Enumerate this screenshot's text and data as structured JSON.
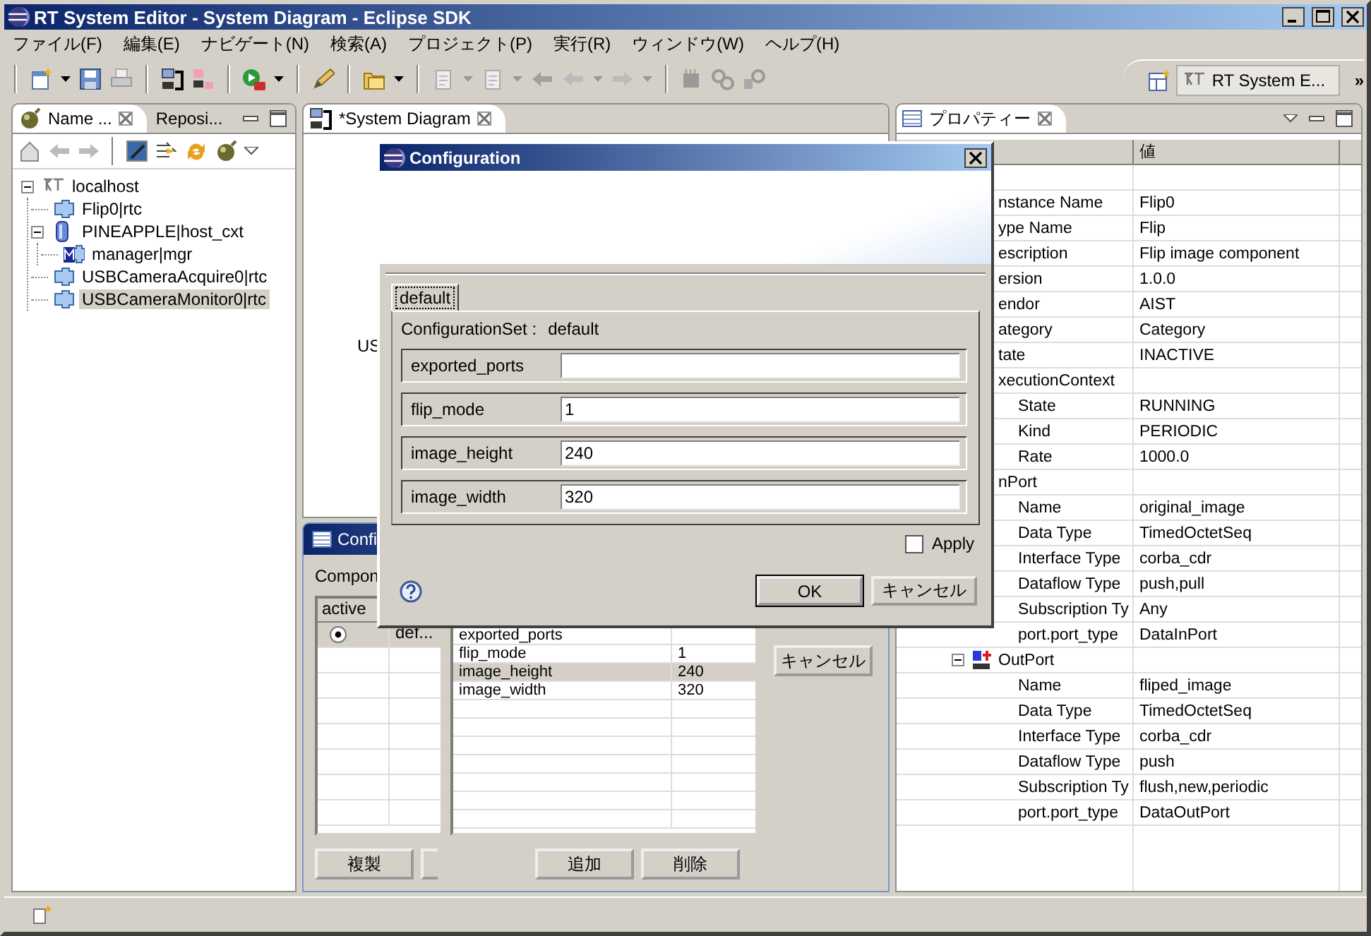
{
  "window": {
    "title": "RT System Editor - System Diagram - Eclipse SDK"
  },
  "menu": [
    "ファイル(F)",
    "編集(E)",
    "ナビゲート(N)",
    "検索(A)",
    "プロジェクト(P)",
    "実行(R)",
    "ウィンドウ(W)",
    "ヘルプ(H)"
  ],
  "perspective": {
    "label": "RT System E...",
    "more": "»"
  },
  "navigator": {
    "tabs": [
      {
        "label": "Name ...",
        "selected": true
      },
      {
        "label": "Reposi...",
        "selected": false
      }
    ],
    "tree": [
      {
        "label": "localhost",
        "kind": "host",
        "selected": false,
        "expanded": true,
        "children": [
          {
            "label": "Flip0|rtc",
            "kind": "rtc",
            "selected": false
          },
          {
            "label": "PINEAPPLE|host_cxt",
            "kind": "context",
            "selected": false,
            "expanded": true,
            "children": [
              {
                "label": "manager|mgr",
                "kind": "manager",
                "selected": false
              }
            ]
          },
          {
            "label": "USBCameraAcquire0|rtc",
            "kind": "rtc",
            "selected": false
          },
          {
            "label": "USBCameraMonitor0|rtc",
            "kind": "rtc",
            "selected": true
          }
        ]
      }
    ]
  },
  "editor": {
    "tab": "*System Diagram",
    "diagram_labels": [
      "US"
    ]
  },
  "config_view": {
    "title": "Confi",
    "component_label": "Compon",
    "sets_columns": [
      "active"
    ],
    "sets": [
      {
        "selected": true,
        "name": "def..."
      }
    ],
    "params": [
      {
        "name": "exported_ports",
        "selected": false
      },
      {
        "name": "flip_mode",
        "value": "1",
        "selected": false
      },
      {
        "name": "image_height",
        "value": "240",
        "selected": true
      },
      {
        "name": "image_width",
        "value": "320",
        "selected": false
      }
    ],
    "side_buttons": [
      "キャンセル"
    ],
    "buttons": [
      "複製",
      "追加",
      "削除"
    ]
  },
  "properties": {
    "tab": "プロパティー",
    "columns": [
      "値"
    ],
    "rows": [
      {
        "key": "nstance Name",
        "value": "Flip0"
      },
      {
        "key": "ype Name",
        "value": "Flip"
      },
      {
        "key": "escription",
        "value": "Flip image component"
      },
      {
        "key": "ersion",
        "value": "1.0.0"
      },
      {
        "key": "endor",
        "value": "AIST"
      },
      {
        "key": "ategory",
        "value": "Category"
      },
      {
        "key": "tate",
        "value": "INACTIVE"
      },
      {
        "key": "xecutionContext",
        "children": [
          {
            "key": "State",
            "value": "RUNNING"
          },
          {
            "key": "Kind",
            "value": "PERIODIC"
          },
          {
            "key": "Rate",
            "value": "1000.0"
          }
        ]
      },
      {
        "key": "nPort",
        "children": [
          {
            "key": "Name",
            "value": "original_image"
          },
          {
            "key": "Data Type",
            "value": "TimedOctetSeq"
          },
          {
            "key": "Interface Type",
            "value": "corba_cdr"
          },
          {
            "key": "Dataflow Type",
            "value": "push,pull"
          },
          {
            "key": "Subscription Ty",
            "value": "Any"
          },
          {
            "key": "port.port_type",
            "value": "DataInPort"
          }
        ]
      },
      {
        "key": "OutPort",
        "kind": "outport",
        "expanded": true,
        "children": [
          {
            "key": "Name",
            "value": "fliped_image"
          },
          {
            "key": "Data Type",
            "value": "TimedOctetSeq"
          },
          {
            "key": "Interface Type",
            "value": "corba_cdr"
          },
          {
            "key": "Dataflow Type",
            "value": "push"
          },
          {
            "key": "Subscription Ty",
            "value": "flush,new,periodic"
          },
          {
            "key": "port.port_type",
            "value": "DataOutPort"
          }
        ]
      }
    ]
  },
  "dialog": {
    "title": "Configuration",
    "tabs": [
      {
        "label": "default",
        "selected": true
      }
    ],
    "set_label": "ConfigurationSet :",
    "set_name": "default",
    "params": [
      {
        "name": "exported_ports"
      },
      {
        "name": "flip_mode",
        "value": "1"
      },
      {
        "name": "image_height",
        "value": "240"
      },
      {
        "name": "image_width",
        "value": "320"
      }
    ],
    "apply": {
      "label": "Apply",
      "checked": false
    },
    "buttons": [
      "OK",
      "キャンセル"
    ]
  }
}
